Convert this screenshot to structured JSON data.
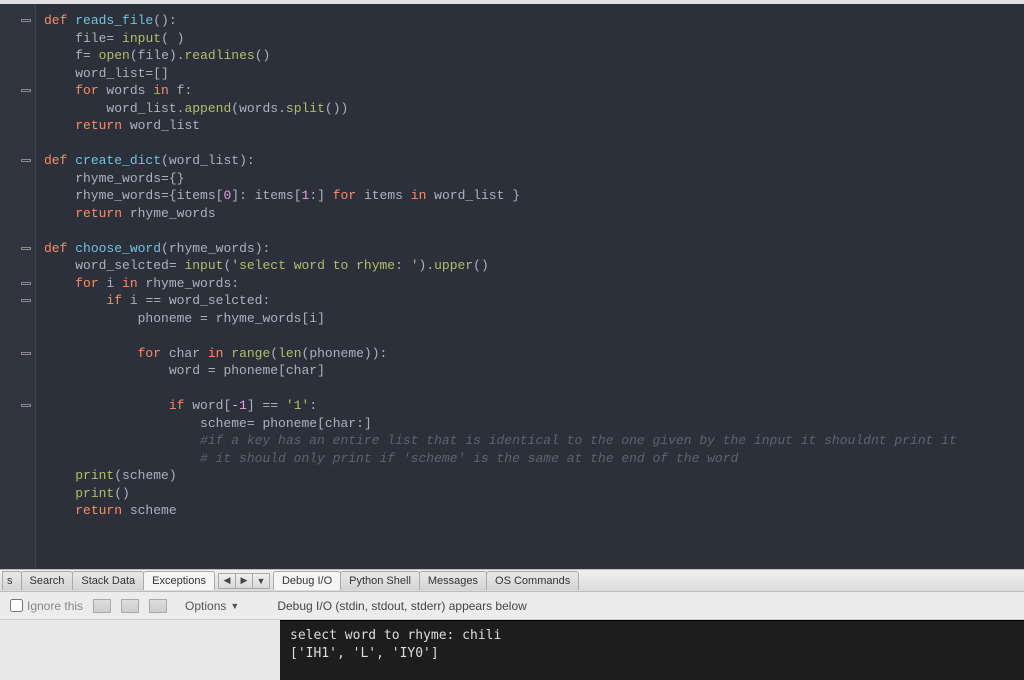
{
  "editor": {
    "lines": [
      {
        "fold": true,
        "html": "<span class='kw'>def</span> <span class='fn'>reads_file</span><span class='punc'>():</span>"
      },
      {
        "fold": false,
        "html": "    file<span class='punc'>=</span> <span class='call'>input</span><span class='punc'>( )</span>"
      },
      {
        "fold": false,
        "html": "    f<span class='punc'>=</span> <span class='call'>open</span><span class='punc'>(</span>file<span class='punc'>).</span><span class='call'>readlines</span><span class='punc'>()</span>"
      },
      {
        "fold": false,
        "html": "    word_list<span class='punc'>=[]</span>"
      },
      {
        "fold": true,
        "html": "    <span class='kw'>for</span> words <span class='kw'>in</span> f<span class='punc'>:</span>"
      },
      {
        "fold": false,
        "html": "        word_list<span class='punc'>.</span><span class='call'>append</span><span class='punc'>(</span>words<span class='punc'>.</span><span class='call'>split</span><span class='punc'>())</span>"
      },
      {
        "fold": false,
        "html": "    <span class='kw'>return</span> word_list"
      },
      {
        "fold": false,
        "html": ""
      },
      {
        "fold": true,
        "html": "<span class='kw'>def</span> <span class='fn'>create_dict</span><span class='punc'>(</span>word_list<span class='punc'>):</span>"
      },
      {
        "fold": false,
        "html": "    rhyme_words<span class='punc'>={}</span>"
      },
      {
        "fold": false,
        "html": "    rhyme_words<span class='punc'>={</span>items<span class='punc'>[</span><span class='num'>0</span><span class='punc'>]:</span> items<span class='punc'>[</span><span class='num'>1</span><span class='punc'>:]</span> <span class='kw'>for</span> items <span class='kw'>in</span> word_list <span class='punc'>}</span>"
      },
      {
        "fold": false,
        "html": "    <span class='kw'>return</span> rhyme_words"
      },
      {
        "fold": false,
        "html": ""
      },
      {
        "fold": true,
        "html": "<span class='kw'>def</span> <span class='fn'>choose_word</span><span class='punc'>(</span>rhyme_words<span class='punc'>):</span>"
      },
      {
        "fold": false,
        "html": "    word_selcted<span class='punc'>=</span> <span class='call'>input</span><span class='punc'>(</span><span class='str'>'select word to rhyme: '</span><span class='punc'>).</span><span class='call'>upper</span><span class='punc'>()</span>"
      },
      {
        "fold": true,
        "html": "    <span class='kw'>for</span> i <span class='kw'>in</span> rhyme_words<span class='punc'>:</span>"
      },
      {
        "fold": true,
        "html": "        <span class='kw'>if</span> i <span class='punc'>==</span> word_selcted<span class='punc'>:</span>"
      },
      {
        "fold": false,
        "html": "            phoneme <span class='punc'>=</span> rhyme_words<span class='punc'>[</span>i<span class='punc'>]</span>"
      },
      {
        "fold": false,
        "html": ""
      },
      {
        "fold": true,
        "html": "            <span class='kw'>for</span> char <span class='kw'>in</span> <span class='call'>range</span><span class='punc'>(</span><span class='call'>len</span><span class='punc'>(</span>phoneme<span class='punc'>)):</span>"
      },
      {
        "fold": false,
        "html": "                word <span class='punc'>=</span> phoneme<span class='punc'>[</span>char<span class='punc'>]</span>"
      },
      {
        "fold": false,
        "html": ""
      },
      {
        "fold": true,
        "html": "                <span class='kw'>if</span> word<span class='punc'>[</span><span class='num'>-1</span><span class='punc'>]</span> <span class='punc'>==</span> <span class='str'>'1'</span><span class='punc'>:</span>"
      },
      {
        "fold": false,
        "html": "                    scheme<span class='punc'>=</span> phoneme<span class='punc'>[</span>char<span class='punc'>:]</span>"
      },
      {
        "fold": false,
        "html": "                    <span class='cm'>#if a key has an entire list that is identical to the one given by the input it shouldnt print it</span>"
      },
      {
        "fold": false,
        "html": "                    <span class='cm'># it should only print if 'scheme' is the same at the end of the word</span>"
      },
      {
        "fold": false,
        "html": "    <span class='call'>print</span><span class='punc'>(</span>scheme<span class='punc'>)</span>"
      },
      {
        "fold": false,
        "html": "    <span class='call'>print</span><span class='punc'>()</span>"
      },
      {
        "fold": false,
        "html": "    <span class='kw'>return</span> scheme"
      }
    ]
  },
  "tabs": {
    "left_cut": "s",
    "items": [
      "Search",
      "Stack Data",
      "Exceptions"
    ],
    "active_index": 2,
    "right_items": [
      "Debug I/O",
      "Python Shell",
      "Messages",
      "OS Commands"
    ]
  },
  "options": {
    "ignore_label": "Ignore this",
    "options_label": "Options",
    "debug_label": "Debug I/O (stdin, stdout, stderr) appears below"
  },
  "console": {
    "line1": "select word to rhyme: chili",
    "line2": "['IH1', 'L', 'IY0']"
  }
}
